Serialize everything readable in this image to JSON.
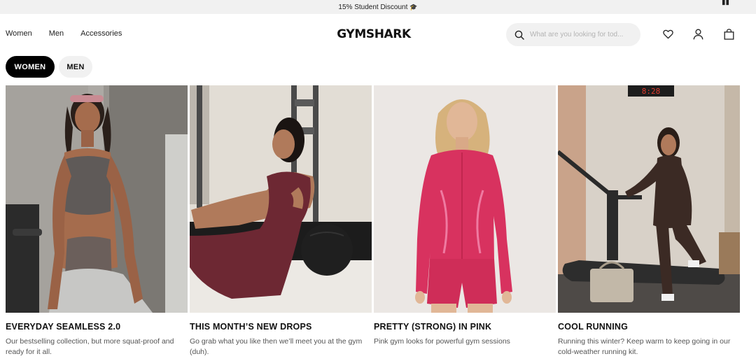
{
  "promo": {
    "text": "15% Student Discount",
    "cap_icon": "graduation-cap-icon",
    "pause_icon": "pause-icon"
  },
  "nav": {
    "items": [
      "Women",
      "Men",
      "Accessories"
    ]
  },
  "brand": {
    "logo": "GYMSHARK"
  },
  "search": {
    "placeholder": "What are you looking for tod...",
    "icon": "search-icon"
  },
  "header_icons": [
    "heart-icon",
    "account-icon",
    "bag-icon"
  ],
  "gender_toggle": {
    "women": "WOMEN",
    "men": "MEN",
    "selected": "WOMEN"
  },
  "cards": [
    {
      "title": "EVERYDAY SEAMLESS 2.0",
      "description": "Our bestselling collection, but more squat-proof and ready for it all."
    },
    {
      "title": "THIS MONTH’S NEW DROPS",
      "description": "Go grab what you like then we’ll meet you at the gym (duh)."
    },
    {
      "title": "PRETTY (STRONG) IN PINK",
      "description": "Pink gym looks for powerful gym sessions"
    },
    {
      "title": "COOL RUNNING",
      "description": "Running this winter? Keep warm to keep going in our cold-weather running kit."
    }
  ],
  "gym_clock": "8:28",
  "colors": {
    "black": "#000000",
    "light_gray": "#f1f1f1",
    "pink": "#d8325f"
  }
}
